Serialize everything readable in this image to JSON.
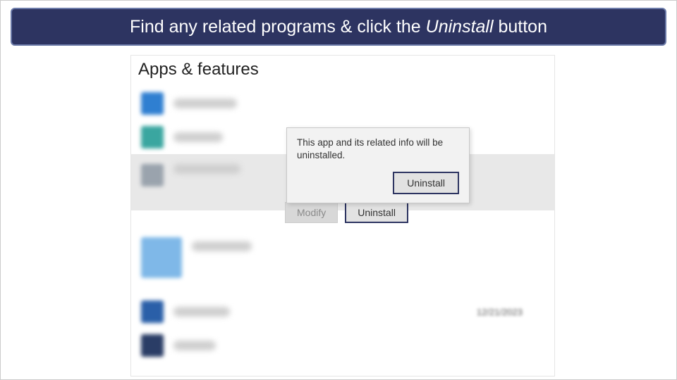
{
  "banner": {
    "prefix": "Find any related programs & click the ",
    "em": "Uninstall",
    "suffix": " button"
  },
  "page_title": "Apps & features",
  "selected_app": {
    "modify_label": "Modify",
    "uninstall_label": "Uninstall"
  },
  "popup": {
    "message": "This app and its related info will be uninstalled.",
    "confirm_label": "Uninstall"
  },
  "rows": {
    "r5_date": "12/21/2023"
  },
  "colors": {
    "icon_blue": "#2f7fd1",
    "icon_teal": "#3aa6a0",
    "icon_grey": "#9aa3ad",
    "icon_lightblue": "#7fb8e8",
    "icon_dblue": "#2a5fa8",
    "icon_navy": "#2a3d66"
  }
}
